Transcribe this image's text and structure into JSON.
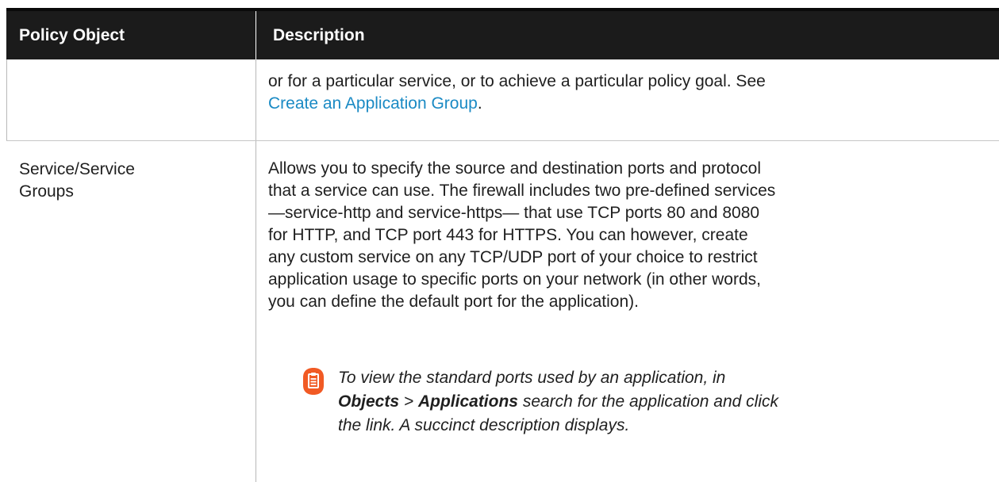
{
  "table": {
    "headers": {
      "col1": "Policy Object",
      "col2": "Description"
    },
    "continued_row": {
      "text_line1": "or for a particular service, or to achieve a particular policy goal. See",
      "link": "Create an Application Group",
      "after_link": "."
    },
    "service_row": {
      "name_line1": "Service/Service",
      "name_line2": "Groups",
      "description": "Allows you to specify the source and destination ports and protocol\nthat a service can use. The firewall includes two pre-defined services\n—service-http and service-https— that use TCP ports 80 and 8080\nfor HTTP, and TCP port 443 for HTTPS. You can however, create\nany custom service on any TCP/UDP port of your choice to restrict\napplication usage to specific ports on your network (in other words,\nyou can define the default port for the application).",
      "note": {
        "icon": "note-icon",
        "line1": "To view the standard ports used by an application, in",
        "objects": "Objects",
        "sep": " > ",
        "applications": "Applications",
        "line2_rest": " search for the application and click",
        "line3": "the link. A succinct description displays."
      }
    }
  },
  "colors": {
    "header_bg": "#1b1b1b",
    "link": "#1a8ac4",
    "note_icon": "#f15a24"
  }
}
